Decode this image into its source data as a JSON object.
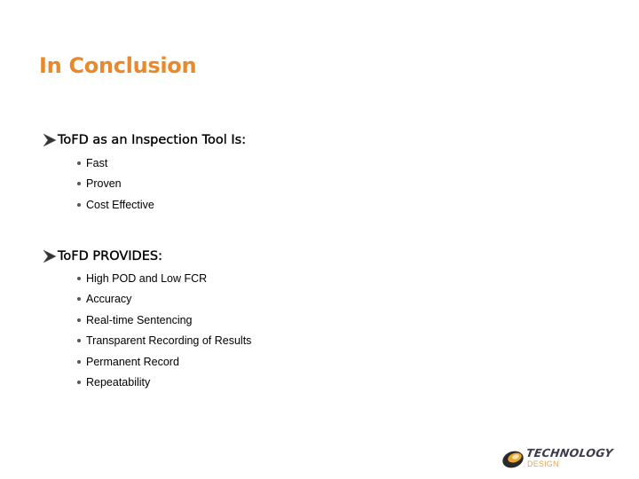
{
  "slide": {
    "title": "In Conclusion",
    "title_color": "#e8892b",
    "sections": [
      {
        "heading": "ToFD as an Inspection Tool Is:",
        "icon": "arrowhead-bullet-icon",
        "items": [
          "Fast",
          "Proven",
          "Cost Effective"
        ]
      },
      {
        "heading": "ToFD PROVIDES:",
        "icon": "arrowhead-bullet-icon",
        "items": [
          "High POD and Low FCR",
          "Accuracy",
          "Real-time Sentencing",
          "Transparent Recording of Results",
          "Permanent Record",
          "Repeatability"
        ]
      }
    ],
    "logo": {
      "name": "TECHNOLOGY",
      "subtitle": "DESIGN",
      "icon": "disc-logo-icon"
    }
  }
}
